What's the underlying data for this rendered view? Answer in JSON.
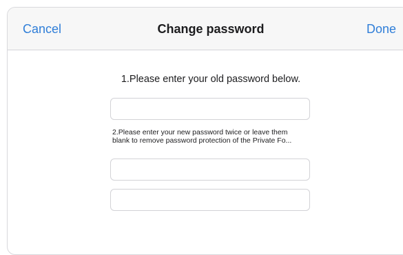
{
  "navbar": {
    "cancel_label": "Cancel",
    "title": "Change password",
    "done_label": "Done"
  },
  "form": {
    "old_password_prompt": "1.Please enter your old password below.",
    "old_password_value": "",
    "new_password_prompt_line1": "2.Please enter your new password twice or leave them",
    "new_password_prompt_line2": "blank to remove password protection of the Private Fo...",
    "new_password_value": "",
    "confirm_password_value": ""
  },
  "colors": {
    "accent": "#2f7ed8",
    "navbar_background": "#f7f7f7",
    "field_border": "#d2d2d6"
  }
}
